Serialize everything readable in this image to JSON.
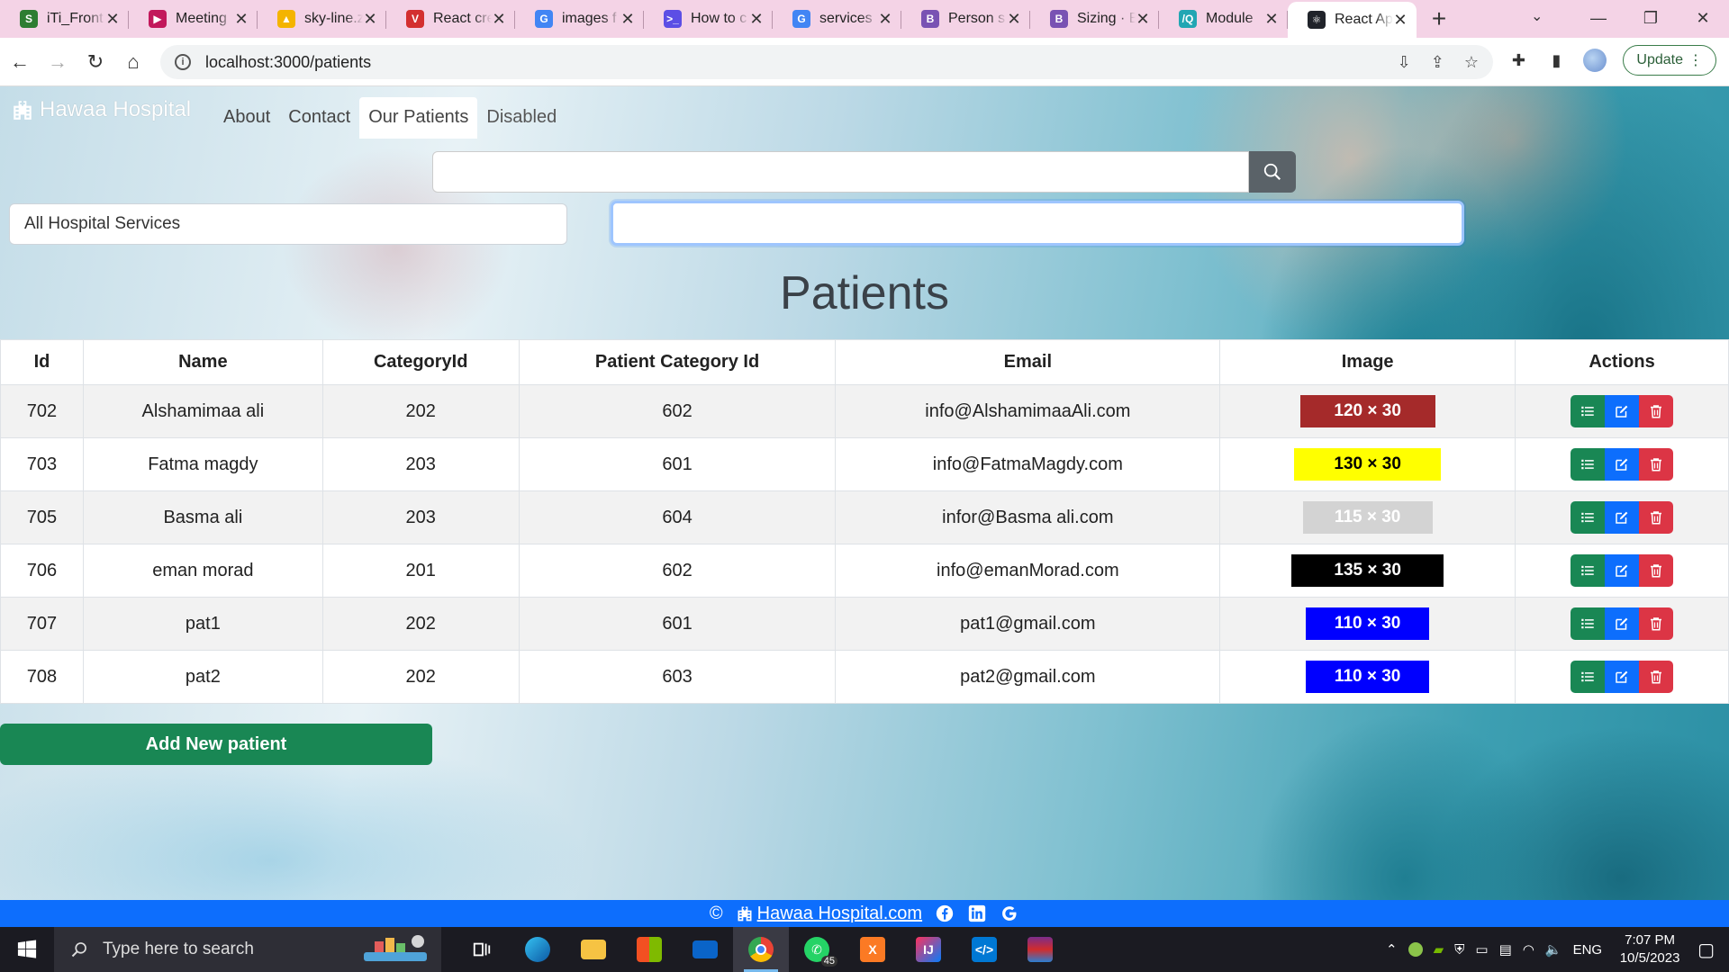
{
  "browser": {
    "tabs": [
      {
        "title": "iTi_Front",
        "icon_color": "#2e7d32",
        "icon_text": "S"
      },
      {
        "title": "Meeting",
        "icon_color": "#c2185b",
        "icon_text": "▶"
      },
      {
        "title": "sky-line.z",
        "icon_color": "#f4b400",
        "icon_text": "▲"
      },
      {
        "title": "React cre",
        "icon_color": "#d32f2f",
        "icon_text": "V"
      },
      {
        "title": "images f",
        "icon_color": "#4285f4",
        "icon_text": "G"
      },
      {
        "title": "How to c",
        "icon_color": "#5c4ee5",
        "icon_text": ">_"
      },
      {
        "title": "services",
        "icon_color": "#4285f4",
        "icon_text": "G"
      },
      {
        "title": "Person s",
        "icon_color": "#7952b3",
        "icon_text": "B"
      },
      {
        "title": "Sizing · B",
        "icon_color": "#7952b3",
        "icon_text": "B"
      },
      {
        "title": "Module",
        "icon_color": "#22a6b3",
        "icon_text": "/Q"
      },
      {
        "title": "React Ap",
        "icon_color": "#20232a",
        "icon_text": "⚛",
        "active": true
      }
    ],
    "url": "localhost:3000/patients",
    "update_label": "Update"
  },
  "app": {
    "brand": "Hawaa Hospital",
    "nav": [
      {
        "label": "About"
      },
      {
        "label": "Contact"
      },
      {
        "label": "Our Patients"
      },
      {
        "label": "Disabled"
      }
    ],
    "search_placeholder": "",
    "filter_select": "All Hospital Services",
    "filter_input_value": "",
    "heading": "Patients",
    "table": {
      "headers": [
        "Id",
        "Name",
        "CategoryId",
        "Patient Category Id",
        "Email",
        "Image",
        "Actions"
      ],
      "rows": [
        {
          "id": "702",
          "name": "Alshamimaa ali",
          "category_id": "202",
          "patient_category_id": "602",
          "email": "info@AlshamimaaAli.com",
          "image_label": "120 × 30",
          "image_bg": "#a52a2a",
          "image_fg": "#ffffff",
          "image_width": 120
        },
        {
          "id": "703",
          "name": "Fatma magdy",
          "category_id": "203",
          "patient_category_id": "601",
          "email": "info@FatmaMagdy.com",
          "image_label": "130 × 30",
          "image_bg": "#ffff00",
          "image_fg": "#000000",
          "image_width": 130
        },
        {
          "id": "705",
          "name": "Basma ali",
          "category_id": "203",
          "patient_category_id": "604",
          "email": "infor@Basma ali.com",
          "image_label": "115 × 30",
          "image_bg": "#d3d3d3",
          "image_fg": "#ffffff",
          "image_width": 115
        },
        {
          "id": "706",
          "name": "eman morad",
          "category_id": "201",
          "patient_category_id": "602",
          "email": "info@emanMorad.com",
          "image_label": "135 × 30",
          "image_bg": "#000000",
          "image_fg": "#ffffff",
          "image_width": 135
        },
        {
          "id": "707",
          "name": "pat1",
          "category_id": "202",
          "patient_category_id": "601",
          "email": "pat1@gmail.com",
          "image_label": "110 × 30",
          "image_bg": "#0000ff",
          "image_fg": "#ffffff",
          "image_width": 110
        },
        {
          "id": "708",
          "name": "pat2",
          "category_id": "202",
          "patient_category_id": "603",
          "email": "pat2@gmail.com",
          "image_label": "110 × 30",
          "image_bg": "#0000ff",
          "image_fg": "#ffffff",
          "image_width": 110
        }
      ]
    },
    "add_button": "Add New patient",
    "footer": {
      "copyright": "©",
      "link": "Hawaa Hospital.com"
    }
  },
  "taskbar": {
    "search_placeholder": "Type here to search",
    "whatsapp_badge": "45",
    "language": "ENG",
    "time": "7:07 PM",
    "date": "10/5/2023"
  }
}
